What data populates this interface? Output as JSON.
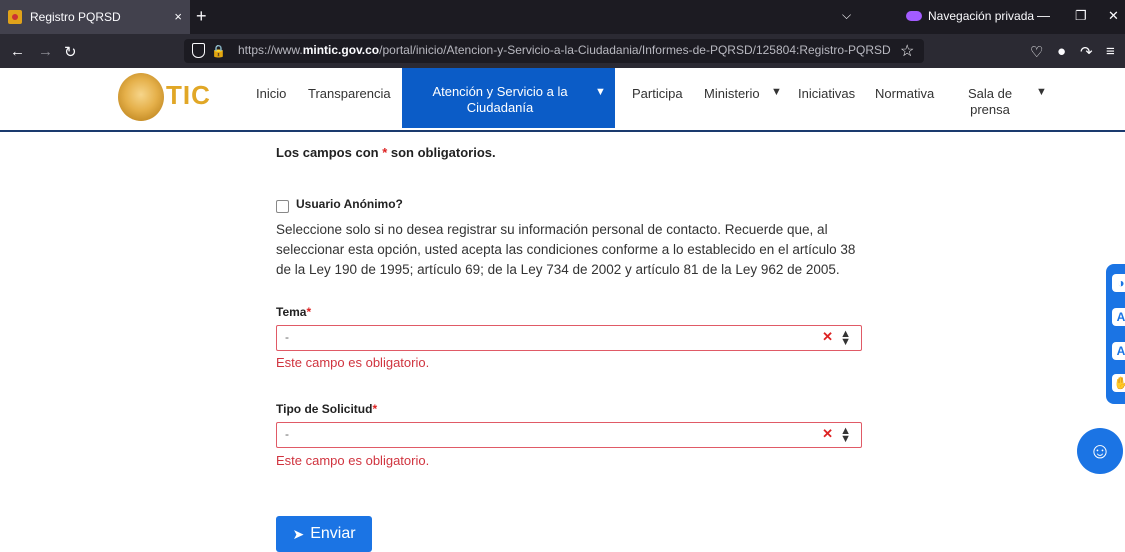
{
  "browser": {
    "tab_title": "Registro PQRSD",
    "tab_close": "×",
    "new_tab": "+",
    "private_label": "Navegación privada",
    "url_prefix": "https://www.",
    "url_domain": "mintic.gov.co",
    "url_path": "/portal/inicio/Atencion-y-Servicio-a-la-Ciudadania/Informes-de-PQRSD/125804:Registro-PQRSD"
  },
  "site": {
    "logo_text": "TIC",
    "menu": [
      {
        "label": "Inicio"
      },
      {
        "label": "Transparencia"
      },
      {
        "label": "Atención y Servicio a la Ciudadanía",
        "active": true
      },
      {
        "label": "Participa"
      },
      {
        "label": "Ministerio"
      },
      {
        "label": "Iniciativas"
      },
      {
        "label": "Normativa"
      },
      {
        "label": "Sala de prensa"
      }
    ],
    "colors": {
      "accent": "#0b5cc7",
      "logo": "#e1a726",
      "error": "#d0343f",
      "button": "#1b74e4"
    }
  },
  "form": {
    "required_note_prefix": "Los campos con ",
    "required_star": "*",
    "required_note_suffix": " son obligatorios.",
    "anonymous_label": "Usuario Anónimo?",
    "anonymous_checked": false,
    "anonymous_description": "Seleccione solo si no desea registrar su información personal de contacto. Recuerde que, al seleccionar esta opción, usted acepta las condiciones conforme a lo establecido en el artículo 38 de la Ley 190 de 1995; artículo 69; de la Ley 734 de 2002 y artículo 81 de la Ley 962 de 2005.",
    "tema_label": "Tema",
    "tema_value": "-",
    "tema_error": "Este campo es obligatorio.",
    "tipo_label": "Tipo de Solicitud",
    "tipo_value": "-",
    "tipo_error": "Este campo es obligatorio.",
    "submit_label": "Enviar"
  },
  "icons": [
    "shield-icon",
    "lock-icon",
    "star-icon",
    "caret-down-icon",
    "clear-icon",
    "sort-arrows-icon",
    "paper-plane-icon",
    "contrast-icon",
    "font-size-icon",
    "sign-language-icon",
    "help-icon"
  ]
}
